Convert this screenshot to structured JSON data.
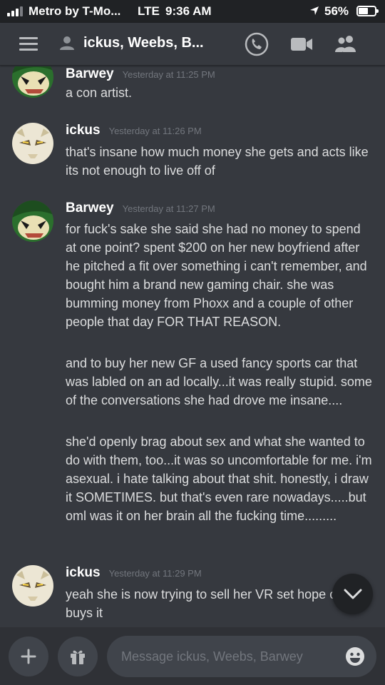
{
  "status_bar": {
    "carrier": "Metro by T-Mo...",
    "network": "LTE",
    "time": "9:36 AM",
    "battery": "56%",
    "battery_level": 0.56
  },
  "header": {
    "title": "ickus, Weebs, B...",
    "icons": [
      "menu-icon",
      "group-dm-icon",
      "call-icon",
      "video-icon",
      "members-icon"
    ]
  },
  "messages": [
    {
      "author": "Barwey",
      "timestamp": "Yesterday at 11:25 PM",
      "text": "a con artist."
    },
    {
      "author": "ickus",
      "timestamp": "Yesterday at 11:26 PM",
      "text": "that's insane how much money she gets and acts like its not enough to live off of"
    },
    {
      "author": "Barwey",
      "timestamp": "Yesterday at 11:27 PM",
      "text": "for fuck's sake she said she had no money to spend at one point? spent $200 on her new boyfriend after he pitched a fit over something i can't remember, and bought him a brand new gaming chair. she was bumming money from Phoxx and a couple of other people that day FOR THAT REASON.",
      "text2": "and to buy her new GF a used fancy sports car that was labled on an ad locally...it was really stupid. some of the conversations she had drove me insane....",
      "text3": "she'd openly brag about sex and what she wanted to do with them, too...it was so uncomfortable for me. i'm asexual. i hate talking about that shit. honestly, i draw it SOMETIMES. but that's even rare nowadays.....but oml was it on her brain all the fucking time........."
    },
    {
      "author": "ickus",
      "timestamp": "Yesterday at 11:29 PM",
      "text": "yeah she is now trying to sell her VR set hope one buys it"
    }
  ],
  "composer": {
    "placeholder": "Message ickus, Weebs, Barwey"
  },
  "colors": {
    "background": "#36393f",
    "status_bar": "#202225",
    "composer": "#2f3136",
    "input": "#40444b",
    "timestamp": "#72767d"
  }
}
